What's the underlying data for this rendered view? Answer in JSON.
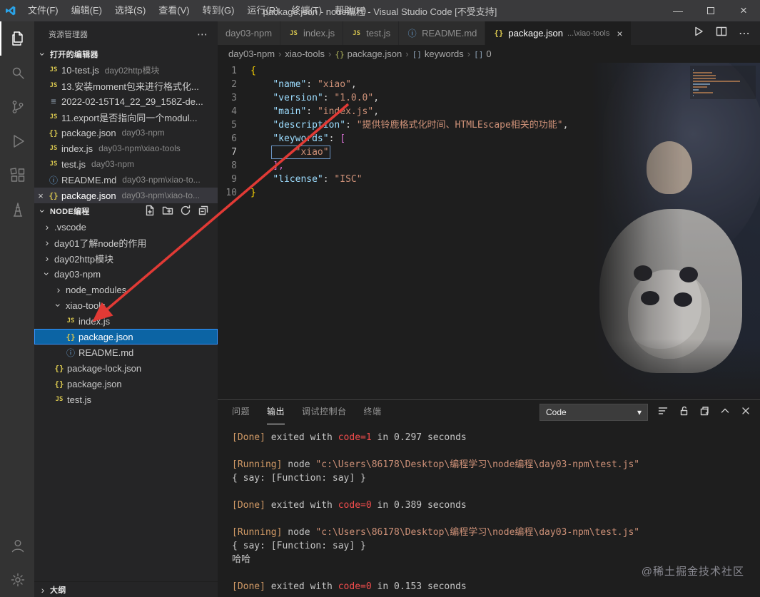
{
  "title_bar": {
    "menus": [
      "文件(F)",
      "编辑(E)",
      "选择(S)",
      "查看(V)",
      "转到(G)",
      "运行(R)",
      "终端(T)",
      "帮助(H)"
    ],
    "title": "package.json - node编程 - Visual Studio Code [不受支持]"
  },
  "glyphs": {
    "js": "JS",
    "json": "{}",
    "readme": "ⓘ",
    "log": "≡",
    "chevron": "›",
    "more": "⋯",
    "close": "×",
    "dropdown": "▾",
    "array": "[]"
  },
  "activity_bar": {
    "active": "explorer",
    "top": [
      "explorer",
      "search",
      "source-control",
      "run-debug",
      "extensions",
      "tower"
    ],
    "bottom": [
      "account",
      "settings"
    ]
  },
  "sidebar": {
    "title": "资源管理器",
    "open_editors": {
      "label": "打开的编辑器",
      "items": [
        {
          "icon": "js",
          "name": "10-test.js",
          "desc": "day02http模块"
        },
        {
          "icon": "js",
          "name": "13.安装moment包来进行格式化..."
        },
        {
          "icon": "log",
          "name": "2022-02-15T14_22_29_158Z-de..."
        },
        {
          "icon": "js",
          "name": "11.export是否指向同一个modul..."
        },
        {
          "icon": "json",
          "name": "package.json",
          "desc": "day03-npm"
        },
        {
          "icon": "js",
          "name": "index.js",
          "desc": "day03-npm\\xiao-tools"
        },
        {
          "icon": "js",
          "name": "test.js",
          "desc": "day03-npm"
        },
        {
          "icon": "readme",
          "name": "README.md",
          "desc": "day03-npm\\xiao-to..."
        },
        {
          "icon": "json",
          "name": "package.json",
          "desc": "day03-npm\\xiao-to...",
          "active": true
        }
      ]
    },
    "tree": {
      "label": "NODE编程",
      "actions": [
        "new-file",
        "new-folder",
        "refresh-explorer",
        "collapse-folders"
      ],
      "items": [
        {
          "indent": 0,
          "chevron": "right",
          "label": ".vscode"
        },
        {
          "indent": 0,
          "chevron": "right",
          "label": "day01了解node的作用"
        },
        {
          "indent": 0,
          "chevron": "right",
          "label": "day02http模块"
        },
        {
          "indent": 0,
          "chevron": "down",
          "label": "day03-npm"
        },
        {
          "indent": 1,
          "chevron": "right",
          "label": "node_modules"
        },
        {
          "indent": 1,
          "chevron": "down",
          "label": "xiao-tools"
        },
        {
          "indent": 2,
          "icon": "js",
          "label": "index.js"
        },
        {
          "indent": 2,
          "icon": "json",
          "label": "package.json",
          "selected": true
        },
        {
          "indent": 2,
          "icon": "readme",
          "label": "README.md"
        },
        {
          "indent": 1,
          "icon": "json",
          "label": "package-lock.json"
        },
        {
          "indent": 1,
          "icon": "json",
          "label": "package.json"
        },
        {
          "indent": 1,
          "icon": "js",
          "label": "test.js"
        }
      ]
    },
    "outline_label": "大纲"
  },
  "editor": {
    "tabs": [
      {
        "label": "day03-npm"
      },
      {
        "icon": "js",
        "label": "index.js"
      },
      {
        "icon": "js",
        "label": "test.js"
      },
      {
        "icon": "readme",
        "label": "README.md"
      },
      {
        "icon": "json",
        "label": "package.json",
        "desc": "...\\xiao-tools",
        "active": true
      }
    ],
    "actions": [
      "run-code",
      "split-editor",
      "more-actions"
    ],
    "breadcrumb": [
      {
        "label": "day03-npm"
      },
      {
        "label": "xiao-tools"
      },
      {
        "icon": "json",
        "label": "package.json"
      },
      {
        "icon": "array",
        "label": "keywords"
      },
      {
        "icon": "array",
        "label": "0"
      }
    ],
    "code_lines": [
      {
        "n": 1,
        "seg": [
          {
            "t": "{",
            "c": "brace1"
          }
        ]
      },
      {
        "n": 2,
        "seg": [
          {
            "t": "    ",
            "c": "plain"
          },
          {
            "t": "\"name\"",
            "c": "key"
          },
          {
            "t": ": ",
            "c": "plain"
          },
          {
            "t": "\"xiao\"",
            "c": "str"
          },
          {
            "t": ",",
            "c": "plain"
          }
        ]
      },
      {
        "n": 3,
        "seg": [
          {
            "t": "    ",
            "c": "plain"
          },
          {
            "t": "\"version\"",
            "c": "key"
          },
          {
            "t": ": ",
            "c": "plain"
          },
          {
            "t": "\"1.0.0\"",
            "c": "str"
          },
          {
            "t": ",",
            "c": "plain"
          }
        ]
      },
      {
        "n": 4,
        "seg": [
          {
            "t": "    ",
            "c": "plain"
          },
          {
            "t": "\"main\"",
            "c": "key"
          },
          {
            "t": ": ",
            "c": "plain"
          },
          {
            "t": "\"index.js\"",
            "c": "str"
          },
          {
            "t": ",",
            "c": "plain"
          }
        ]
      },
      {
        "n": 5,
        "seg": [
          {
            "t": "    ",
            "c": "plain"
          },
          {
            "t": "\"description\"",
            "c": "key"
          },
          {
            "t": ": ",
            "c": "plain"
          },
          {
            "t": "\"提供铃鹿格式化时间、HTMLEscape相关的功能\"",
            "c": "str"
          },
          {
            "t": ",",
            "c": "plain"
          }
        ]
      },
      {
        "n": 6,
        "seg": [
          {
            "t": "    ",
            "c": "plain"
          },
          {
            "t": "\"keywords\"",
            "c": "key"
          },
          {
            "t": ": ",
            "c": "plain"
          },
          {
            "t": "[",
            "c": "bracket2"
          }
        ]
      },
      {
        "n": 7,
        "current": true,
        "seg": [
          {
            "t": "    ",
            "c": "plain"
          },
          {
            "t": "    \"xiao\"",
            "c": "str",
            "box": true
          }
        ]
      },
      {
        "n": 8,
        "seg": [
          {
            "t": "    ",
            "c": "plain"
          },
          {
            "t": "],",
            "c": "bracket2"
          }
        ]
      },
      {
        "n": 9,
        "seg": [
          {
            "t": "    ",
            "c": "plain"
          },
          {
            "t": "\"license\"",
            "c": "key"
          },
          {
            "t": ": ",
            "c": "plain"
          },
          {
            "t": "\"ISC\"",
            "c": "str"
          }
        ]
      },
      {
        "n": 10,
        "seg": [
          {
            "t": "}",
            "c": "brace1"
          }
        ]
      }
    ]
  },
  "panel": {
    "tabs": [
      "问题",
      "输出",
      "调试控制台",
      "终端"
    ],
    "active_tab": "输出",
    "channel": "Code",
    "actions": [
      "clear-output",
      "unlock",
      "pages",
      "maximize-panel",
      "close-panel"
    ],
    "output": [
      [
        {
          "t": "[Done]",
          "c": "tag"
        },
        {
          "t": " exited with ",
          "c": "plain"
        },
        {
          "t": "code=1",
          "c": "code"
        },
        {
          "t": " in 0.297 seconds",
          "c": "plain"
        }
      ],
      [],
      [
        {
          "t": "[Running]",
          "c": "tag"
        },
        {
          "t": " node ",
          "c": "plain"
        },
        {
          "t": "\"c:\\Users\\86178\\Desktop\\编程学习\\node编程\\day03-npm\\test.js\"",
          "c": "path"
        }
      ],
      [
        {
          "t": "{ say: [Function: say] }",
          "c": "plain"
        }
      ],
      [],
      [
        {
          "t": "[Done]",
          "c": "tag"
        },
        {
          "t": " exited with ",
          "c": "plain"
        },
        {
          "t": "code=0",
          "c": "code"
        },
        {
          "t": " in 0.389 seconds",
          "c": "plain"
        }
      ],
      [],
      [
        {
          "t": "[Running]",
          "c": "tag"
        },
        {
          "t": " node ",
          "c": "plain"
        },
        {
          "t": "\"c:\\Users\\86178\\Desktop\\编程学习\\node编程\\day03-npm\\test.js\"",
          "c": "path"
        }
      ],
      [
        {
          "t": "{ say: [Function: say] }",
          "c": "plain"
        }
      ],
      [
        {
          "t": "哈哈",
          "c": "plain"
        }
      ],
      [],
      [
        {
          "t": "[Done]",
          "c": "tag"
        },
        {
          "t": " exited with ",
          "c": "plain"
        },
        {
          "t": "code=0",
          "c": "code"
        },
        {
          "t": " in 0.153 seconds",
          "c": "plain"
        }
      ]
    ]
  },
  "watermark": "@稀土掘金技术社区",
  "annotation": {
    "arrow_color": "#e13a35"
  }
}
